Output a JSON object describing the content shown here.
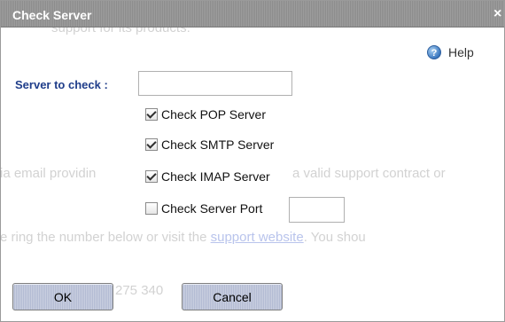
{
  "dialog": {
    "title": "Check Server",
    "close_glyph": "×",
    "help_label": "Help",
    "help_icon": "help-icon"
  },
  "form": {
    "server_label": "Server to check :",
    "server_value": "",
    "checkboxes": [
      {
        "label": "Check POP Server",
        "checked": true
      },
      {
        "label": "Check SMTP Server",
        "checked": true
      },
      {
        "label": "Check IMAP Server",
        "checked": true
      },
      {
        "label": "Check Server Port",
        "checked": false
      }
    ],
    "port_value": ""
  },
  "buttons": {
    "ok": "OK",
    "cancel": "Cancel"
  },
  "background": {
    "line1": "support for its products:",
    "line2a": "ia email providin",
    "line2b": "a valid support contract or",
    "line3a": "e ring the number below or visit the ",
    "line3_link": "support website",
    "line3b": ". You shou",
    "line4": "275 340"
  },
  "colors": {
    "title_bar": "#959595",
    "label_blue": "#1f3d8a",
    "button_face": "#bec5db"
  }
}
